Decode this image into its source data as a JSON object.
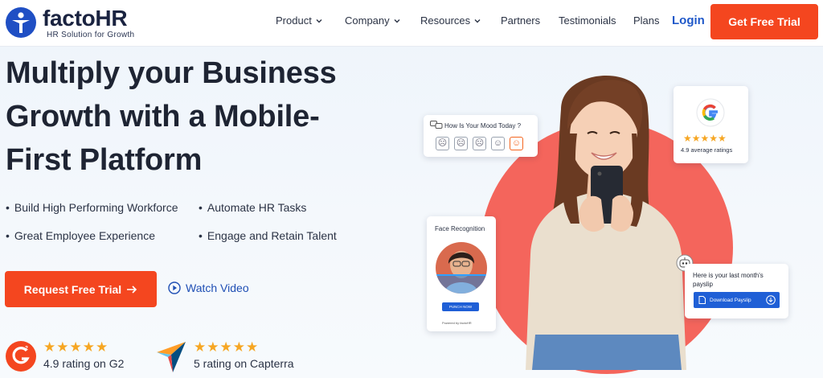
{
  "brand": {
    "name": "factoHR",
    "tagline": "HR Solution for Growth"
  },
  "nav": {
    "items": [
      {
        "label": "Product",
        "dropdown": true
      },
      {
        "label": "Company",
        "dropdown": true
      },
      {
        "label": "Resources",
        "dropdown": true
      },
      {
        "label": "Partners",
        "dropdown": false
      },
      {
        "label": "Testimonials",
        "dropdown": false
      },
      {
        "label": "Plans",
        "dropdown": false
      }
    ],
    "login": "Login",
    "cta": "Get Free Trial"
  },
  "hero": {
    "headline_lines": [
      "Multiply your Business",
      "Growth with a Mobile-",
      "First Platform"
    ],
    "features": [
      "Build High Performing Workforce",
      "Automate HR Tasks",
      "Great Employee Experience",
      "Engage and Retain Talent"
    ],
    "primary_cta": "Request Free Trial",
    "secondary_cta": "Watch Video"
  },
  "ratings": [
    {
      "source_icon": "g2-logo-icon",
      "stars": 5,
      "text": "4.9 rating on G2"
    },
    {
      "source_icon": "capterra-logo-icon",
      "stars": 5,
      "text": "5 rating on Capterra"
    }
  ],
  "widgets": {
    "mood": {
      "title": "How Is Your Mood Today ?"
    },
    "google": {
      "stars": 5,
      "text": "4.9 average ratings"
    },
    "face": {
      "title": "Face Recognition",
      "button": "PUNCH NOW",
      "powered": "Powered by factoHR"
    },
    "payslip": {
      "text": "Here is your last month's payslip",
      "button": "Download Payslip"
    }
  },
  "colors": {
    "accent": "#f4461f",
    "link": "#1f58c9",
    "circle": "#f4655c",
    "star": "#f6a623"
  }
}
